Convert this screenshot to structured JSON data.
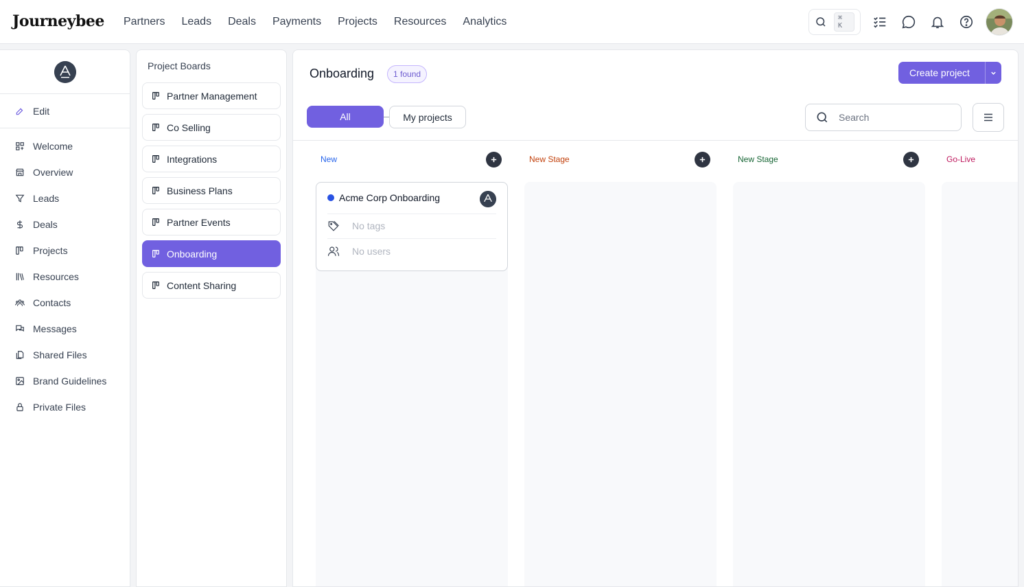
{
  "app": {
    "logo": "Journeybee",
    "nav": [
      "Partners",
      "Leads",
      "Deals",
      "Payments",
      "Projects",
      "Resources",
      "Analytics"
    ],
    "shortcut": "⌘ K"
  },
  "colors": {
    "accent": "#7160e0",
    "stage_new": "#2563eb",
    "stage_new_stage_1": "#c2410c",
    "stage_new_stage_2": "#166534",
    "stage_go_live": "#be185d",
    "card_dot": "#2952e3"
  },
  "sidebar": {
    "edit_label": "Edit",
    "items": [
      {
        "label": "Welcome",
        "icon": "widgets-icon"
      },
      {
        "label": "Overview",
        "icon": "store-icon"
      },
      {
        "label": "Leads",
        "icon": "funnel-icon"
      },
      {
        "label": "Deals",
        "icon": "dollar-icon"
      },
      {
        "label": "Projects",
        "icon": "board-icon"
      },
      {
        "label": "Resources",
        "icon": "books-icon"
      },
      {
        "label": "Contacts",
        "icon": "contacts-icon"
      },
      {
        "label": "Messages",
        "icon": "messages-icon"
      },
      {
        "label": "Shared Files",
        "icon": "files-icon"
      },
      {
        "label": "Brand Guidelines",
        "icon": "image-icon"
      },
      {
        "label": "Private Files",
        "icon": "lock-icon"
      }
    ]
  },
  "boards": {
    "title": "Project Boards",
    "items": [
      {
        "label": "Partner Management",
        "active": false
      },
      {
        "label": "Co Selling",
        "active": false
      },
      {
        "label": "Integrations",
        "active": false
      },
      {
        "label": "Business Plans",
        "active": false
      },
      {
        "label": "Partner Events",
        "active": false
      },
      {
        "label": "Onboarding",
        "active": true
      },
      {
        "label": "Content Sharing",
        "active": false
      }
    ]
  },
  "main": {
    "title": "Onboarding",
    "found": "1 found",
    "create_label": "Create project",
    "filter_all": "All",
    "filter_mine": "My projects",
    "search_placeholder": "Search"
  },
  "columns": [
    {
      "name": "New"
    },
    {
      "name": "New Stage"
    },
    {
      "name": "New Stage"
    },
    {
      "name": "Go-Live"
    }
  ],
  "card": {
    "title": "Acme Corp Onboarding",
    "tags": "No tags",
    "users": "No users"
  }
}
